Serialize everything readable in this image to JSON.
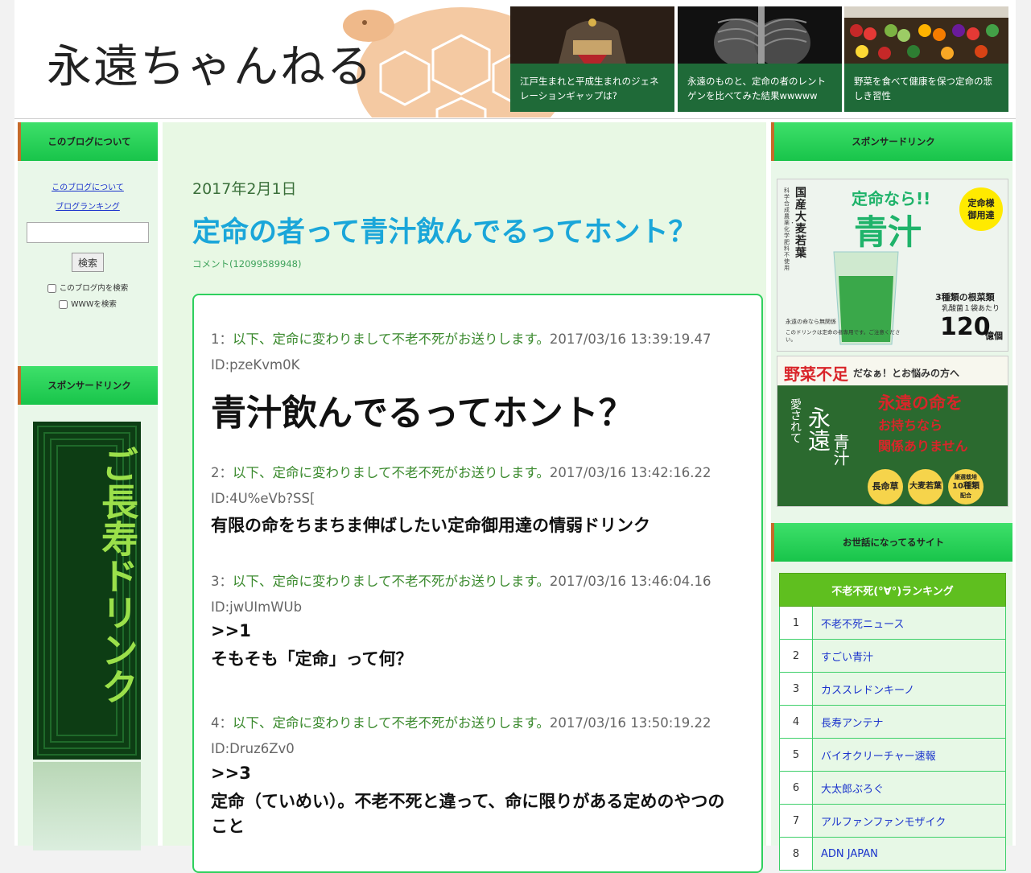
{
  "header": {
    "logo": "永遠ちゃんねる",
    "cards": [
      {
        "caption": "江戸生まれと平成生まれのジェネレーションギャップは?"
      },
      {
        "caption": "永遠のものと、定命の者のレントゲンを比べてみた結果wwwww"
      },
      {
        "caption": "野菜を食べて健康を保つ定命の悲しき習性"
      }
    ]
  },
  "left": {
    "about_title": "このブログについて",
    "links": [
      "このブログについて",
      "ブログランキング"
    ],
    "search": {
      "placeholder": "",
      "button": "検索"
    },
    "checks": [
      "このブログ内を検索",
      "WWWを検索"
    ],
    "sponsor_title": "スポンサードリンク",
    "banner_text": "ご長寿ドリンク"
  },
  "post": {
    "date": "2017年2月1日",
    "title": "定命の者って青汁飲んでるってホント？",
    "comment": "コメント(12099589948)",
    "responses": [
      {
        "num": "1：",
        "name": "以下、定命に変わりまして不老不死がお送りします。",
        "datetime": "2017/03/16 13:39:19.47",
        "id": "ID:pzeKvm0K",
        "body": [
          "青汁飲んでるってホント？"
        ]
      },
      {
        "num": "2：",
        "name": "以下、定命に変わりまして不老不死がお送りします。",
        "datetime": "2017/03/16 13:42:16.22",
        "id": "ID:4U%eVb?SS[",
        "body": [
          "有限の命をちまちま伸ばしたい定命御用達の情弱ドリンク"
        ]
      },
      {
        "num": "3：",
        "name": "以下、定命に変わりまして不老不死がお送りします。",
        "datetime": "2017/03/16 13:46:04.16",
        "id": "ID:jwUImWUb",
        "body": [
          ">>1",
          "そもそも「定命」って何？"
        ]
      },
      {
        "num": "4：",
        "name": "以下、定命に変わりまして不老不死がお送りします。",
        "datetime": "2017/03/16 13:50:19.22",
        "id": "ID:Druz6Zv0",
        "body": [
          ">>3",
          "定命（ていめい）。不老不死と違って、命に限りがある定めのやつの",
          "こと"
        ]
      }
    ]
  },
  "right": {
    "sponsor_title": "スポンサードリンク",
    "ad1": {
      "tag": "定命なら!!",
      "product": "青汁",
      "badge1": "定命様",
      "badge2": "御用達",
      "vert": "国産大麦若葉",
      "sub1": "3種類の根菜類",
      "sub2": "乳酸菌１袋あたり",
      "count": "120",
      "unit": "億個",
      "note1": "永遠の命なら無関係",
      "note2": "このドリンクは定命の者専用です。ご注意ください。",
      "side": "科学合成農薬・化学肥料不使用"
    },
    "ad2": {
      "line1a": "野菜不足",
      "line1b": "だなぁ！とお悩みの方へ",
      "vert": [
        "愛されて",
        "永遠",
        "青汁"
      ],
      "msg1": "永遠の命を",
      "msg2": "お持ちなら",
      "msg3": "関係ありません",
      "badges": [
        "長命草",
        "大麦若葉",
        "10種類"
      ],
      "badge3sub": "厳選栽培",
      "badge3sub2": "配合"
    },
    "friends_title": "お世話になってるサイト",
    "ranking_title": "不老不死(°∀°)ランキング",
    "ranking": [
      {
        "num": "1",
        "name": "不老不死ニュース"
      },
      {
        "num": "2",
        "name": "すごい青汁"
      },
      {
        "num": "3",
        "name": "カススレドンキーノ"
      },
      {
        "num": "4",
        "name": "長寿アンテナ"
      },
      {
        "num": "5",
        "name": "バイオクリーチャー速報"
      },
      {
        "num": "6",
        "name": "大太郎ぶろぐ"
      },
      {
        "num": "7",
        "name": "アルファンファンモザイク"
      },
      {
        "num": "8",
        "name": "ADN JAPAN"
      }
    ]
  }
}
